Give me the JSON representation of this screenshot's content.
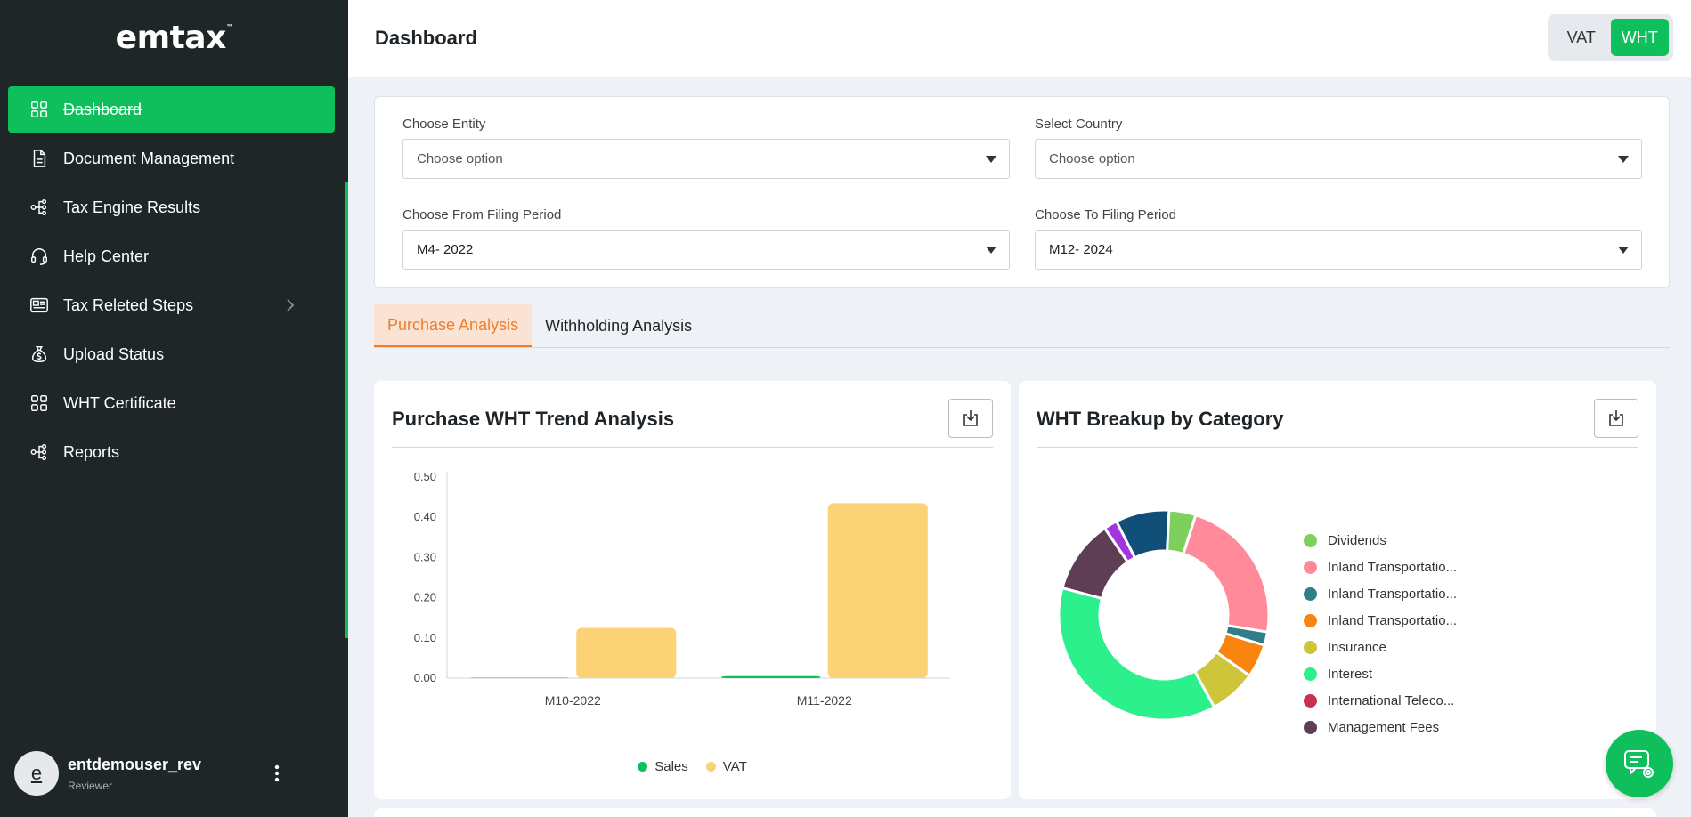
{
  "app": {
    "logo": "emtax",
    "logo_tm": "™"
  },
  "sidebar": {
    "items": [
      {
        "label": "Dashboard",
        "icon": "grid-icon",
        "active": true
      },
      {
        "label": "Document Management",
        "icon": "document-icon"
      },
      {
        "label": "Tax Engine Results",
        "icon": "hierarchy-icon"
      },
      {
        "label": "Help Center",
        "icon": "headset-icon"
      },
      {
        "label": "Tax Releted Steps",
        "icon": "list-card-icon",
        "has_submenu": true
      },
      {
        "label": "Upload Status",
        "icon": "money-bag-icon"
      },
      {
        "label": "WHT Certificate",
        "icon": "grid-icon"
      },
      {
        "label": "Reports",
        "icon": "hierarchy-icon"
      }
    ],
    "user": {
      "initial": "e",
      "name": "entdemouser_rev",
      "role": "Reviewer"
    }
  },
  "header": {
    "title": "Dashboard",
    "toggle": {
      "options": [
        "VAT",
        "WHT"
      ],
      "selected": "WHT"
    }
  },
  "filters": {
    "entity": {
      "label": "Choose Entity",
      "value": "Choose option"
    },
    "country": {
      "label": "Select Country",
      "value": "Choose option"
    },
    "from_period": {
      "label": "Choose From Filing Period",
      "value": "M4- 2022"
    },
    "to_period": {
      "label": "Choose To Filing Period",
      "value": "M12- 2024"
    }
  },
  "tabs": [
    {
      "label": "Purchase Analysis",
      "active": true
    },
    {
      "label": "Withholding Analysis"
    }
  ],
  "trend_card": {
    "title": "Purchase WHT Trend Analysis"
  },
  "breakup_card": {
    "title": "WHT Breakup by Category"
  },
  "colors": {
    "accent": "#0fbf5b",
    "sidebar_bg": "#1f2628",
    "tab_active": "#f07c2c"
  },
  "chart_data": [
    {
      "type": "bar",
      "title": "Purchase WHT Trend Analysis",
      "categories": [
        "M10-2022",
        "M11-2022"
      ],
      "series": [
        {
          "name": "Sales",
          "color": "#0fbf5b",
          "values": [
            0.0,
            0.005
          ]
        },
        {
          "name": "VAT",
          "color": "#fcd277",
          "values": [
            0.125,
            0.435
          ]
        }
      ],
      "ylim": [
        0,
        0.5
      ],
      "yticks": [
        "0.00",
        "0.10",
        "0.20",
        "0.30",
        "0.40",
        "0.50"
      ],
      "legend": "bottom"
    },
    {
      "type": "pie",
      "title": "WHT Breakup by Category",
      "donut": true,
      "slices": [
        {
          "label": "Dividends",
          "color": "#7fcf5d",
          "value": 4
        },
        {
          "label": "Inland Transportatio...",
          "color": "#ff8a9a",
          "value": 22
        },
        {
          "label": "Inland Transportatio...",
          "color": "#2f7f88",
          "value": 2
        },
        {
          "label": "Inland Transportatio...",
          "color": "#f98410",
          "value": 5
        },
        {
          "label": "Insurance",
          "color": "#cdc53a",
          "value": 7
        },
        {
          "label": "Interest",
          "color": "#2cf08c",
          "value": 36
        },
        {
          "label": "International Teleco...",
          "color": "#c9304f",
          "value": 0
        },
        {
          "label": "Management Fees",
          "color": "#5e3e55",
          "value": 11
        },
        {
          "label": "",
          "color": "#a335e0",
          "value": 2
        },
        {
          "label": "",
          "color": "#0f4f78",
          "value": 8
        }
      ],
      "legend": "right"
    }
  ]
}
